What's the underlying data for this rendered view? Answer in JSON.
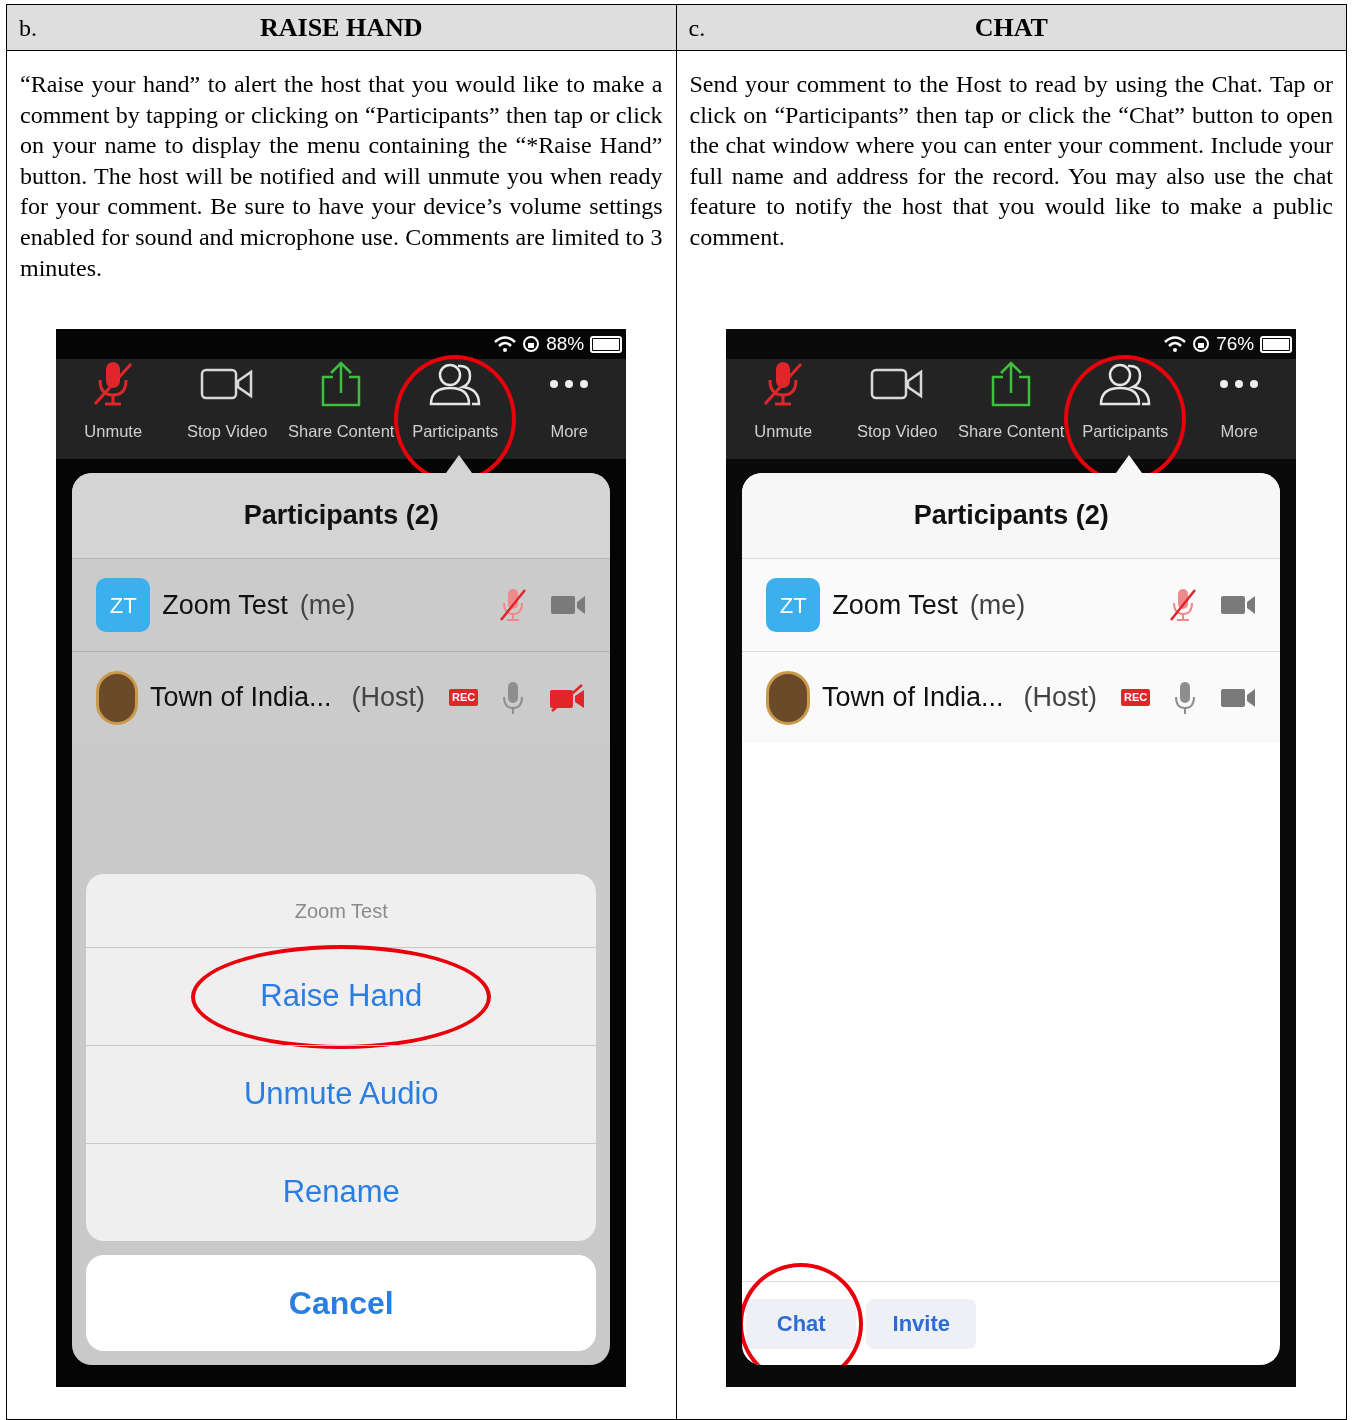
{
  "panels": [
    {
      "letter": "b.",
      "title": "RAISE HAND",
      "description": "“Raise your hand” to alert the host that you would like to make a comment by tapping or clicking on “Participants” then tap or click on your name to display the menu containing the “*Raise Hand” button.  The host will be notified and will unmute you when ready for your comment.  Be sure to have your device’s volume settings enabled for sound and microphone use.  Comments are limited to 3 minutes.",
      "phone": {
        "dimmed": true,
        "battery": "88%",
        "toolbar": [
          {
            "kind": "mic",
            "label": "Unmute",
            "circled": false
          },
          {
            "kind": "video",
            "label": "Stop Video",
            "circled": false
          },
          {
            "kind": "share",
            "label": "Share Content",
            "circled": false
          },
          {
            "kind": "participants",
            "label": "Participants",
            "circled": true
          },
          {
            "kind": "more",
            "label": "More",
            "circled": false
          }
        ],
        "list_title": "Participants (2)",
        "rows": [
          {
            "kind": "initials",
            "initials": "ZT",
            "name": "Zoom Test",
            "tag": "(me)",
            "muted": true,
            "video_off": false
          },
          {
            "kind": "logo",
            "name": "Town of India...",
            "tag": "(Host)",
            "rec": "REC",
            "muted": false,
            "video_off": true
          }
        ],
        "action_sheet": {
          "title": "Zoom Test",
          "actions": [
            {
              "label": "Raise Hand",
              "circled": true
            },
            {
              "label": "Unmute Audio",
              "circled": false
            },
            {
              "label": "Rename",
              "circled": false
            }
          ],
          "cancel": "Cancel"
        }
      }
    },
    {
      "letter": "c.",
      "title": "CHAT",
      "description": "Send your comment to the Host to read by using the Chat.  Tap or click on “Participants” then tap or click the “Chat” button to open the chat window where you can enter your comment.  Include your full name and address for the record.  You may also use the chat feature to notify the host that you would like to make a public comment.",
      "phone": {
        "dimmed": false,
        "battery": "76%",
        "toolbar": [
          {
            "kind": "mic",
            "label": "Unmute",
            "circled": false
          },
          {
            "kind": "video",
            "label": "Stop Video",
            "circled": false
          },
          {
            "kind": "share",
            "label": "Share Content",
            "circled": false
          },
          {
            "kind": "participants",
            "label": "Participants",
            "circled": true
          },
          {
            "kind": "more",
            "label": "More",
            "circled": false
          }
        ],
        "list_title": "Participants (2)",
        "rows": [
          {
            "kind": "initials",
            "initials": "ZT",
            "name": "Zoom Test",
            "tag": "(me)",
            "muted": true,
            "video_off": false
          },
          {
            "kind": "logo",
            "name": "Town of India...",
            "tag": "(Host)",
            "rec": "REC",
            "muted": false,
            "video_off": false
          }
        ],
        "bottom_buttons": [
          {
            "label": "Chat",
            "circled": true
          },
          {
            "label": "Invite",
            "circled": false
          }
        ]
      }
    }
  ]
}
